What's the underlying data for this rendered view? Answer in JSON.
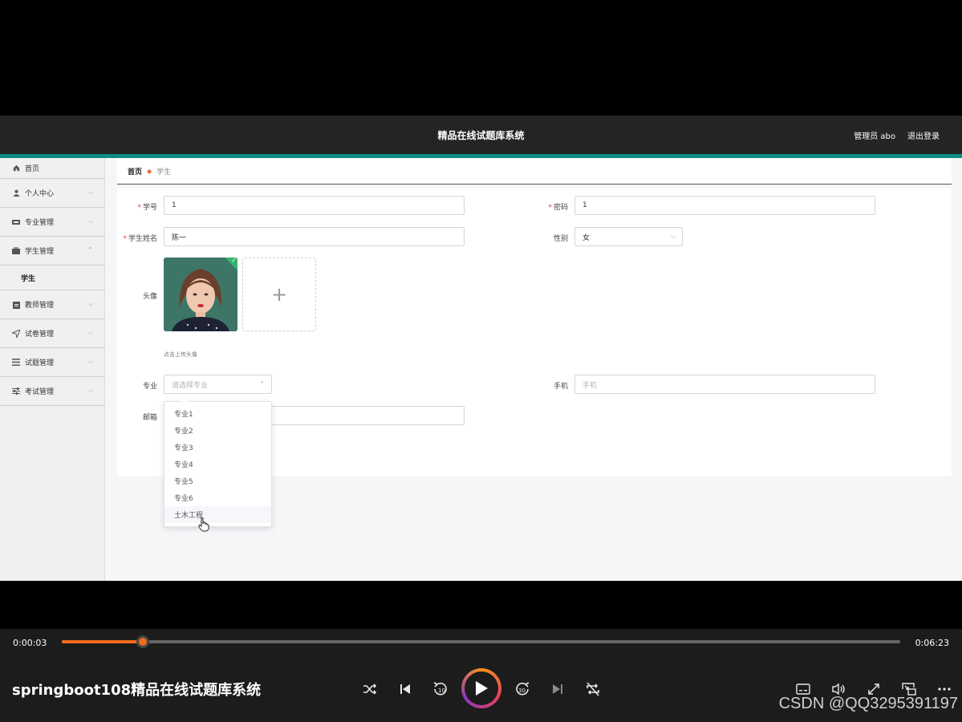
{
  "app": {
    "title": "精品在线试题库系统",
    "user_label": "管理员 abo",
    "logout_label": "退出登录",
    "accent_color": "#0f8b84"
  },
  "sidebar": {
    "items": [
      {
        "label": "首页",
        "icon": "home-icon"
      },
      {
        "label": "个人中心",
        "icon": "user-icon"
      },
      {
        "label": "专业管理",
        "icon": "major-icon"
      },
      {
        "label": "学生管理",
        "icon": "briefcase-icon",
        "expanded": true,
        "children": [
          {
            "label": "学生"
          }
        ]
      },
      {
        "label": "教师管理",
        "icon": "clipboard-icon"
      },
      {
        "label": "试卷管理",
        "icon": "send-icon"
      },
      {
        "label": "试题管理",
        "icon": "list-icon"
      },
      {
        "label": "考试管理",
        "icon": "sliders-icon"
      }
    ]
  },
  "breadcrumb": {
    "home": "首页",
    "current": "学生"
  },
  "form": {
    "student_no": {
      "label": "学号",
      "value": "1"
    },
    "password": {
      "label": "密码",
      "value": "1"
    },
    "name": {
      "label": "学生姓名",
      "value": "陈一"
    },
    "gender": {
      "label": "性别",
      "value": "女"
    },
    "avatar": {
      "label": "头像",
      "hint": "点击上传头像"
    },
    "major": {
      "label": "专业",
      "placeholder": "请选择专业"
    },
    "phone": {
      "label": "手机",
      "placeholder": "手机"
    },
    "email": {
      "label": "邮箱"
    }
  },
  "major_options": [
    "专业1",
    "专业2",
    "专业3",
    "专业4",
    "专业5",
    "专业6",
    "土木工程"
  ],
  "player": {
    "current_time": "0:00:03",
    "total_time": "0:06:23",
    "progress": 0.0965,
    "video_title": "springboot108精品在线试题库系统",
    "progress_color": "#f26b1d",
    "watermark": "CSDN @QQ3295391197",
    "controls": [
      "shuffle-icon",
      "skip-back-icon",
      "rewind-10-icon",
      "play-icon",
      "forward-30-icon",
      "skip-forward-icon",
      "repeat-icon",
      "subtitles-icon",
      "volume-icon",
      "fullscreen-icon",
      "mini-player-icon",
      "more-icon"
    ]
  }
}
